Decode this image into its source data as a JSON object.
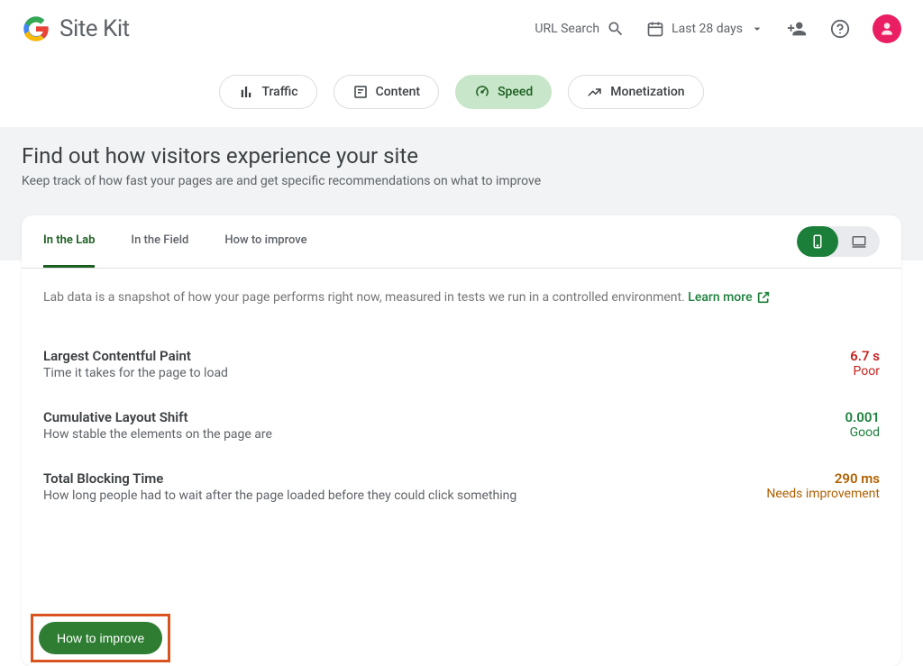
{
  "header": {
    "product_name": "Site Kit",
    "url_search_label": "URL Search",
    "date_range_label": "Last 28 days"
  },
  "nav": {
    "items": [
      {
        "label": "Traffic",
        "icon": "bar-chart-icon"
      },
      {
        "label": "Content",
        "icon": "content-icon"
      },
      {
        "label": "Speed",
        "icon": "speed-icon"
      },
      {
        "label": "Monetization",
        "icon": "trending-icon"
      }
    ]
  },
  "hero": {
    "title": "Find out how visitors experience your site",
    "subtitle": "Keep track of how fast your pages are and get specific recommendations on what to improve"
  },
  "card": {
    "tabs": [
      {
        "label": "In the Lab"
      },
      {
        "label": "In the Field"
      },
      {
        "label": "How to improve"
      }
    ],
    "lab_intro": "Lab data is a snapshot of how your page performs right now, measured in tests we run in a controlled environment.",
    "learn_more_label": "Learn more",
    "metrics": [
      {
        "title": "Largest Contentful Paint",
        "desc": "Time it takes for the page to load",
        "value": "6.7 s",
        "rating": "Poor",
        "class": "poor"
      },
      {
        "title": "Cumulative Layout Shift",
        "desc": "How stable the elements on the page are",
        "value": "0.001",
        "rating": "Good",
        "class": "good"
      },
      {
        "title": "Total Blocking Time",
        "desc": "How long people had to wait after the page loaded before they could click something",
        "value": "290 ms",
        "rating": "Needs improvement",
        "class": "needs"
      }
    ],
    "how_to_improve_button": "How to improve"
  }
}
